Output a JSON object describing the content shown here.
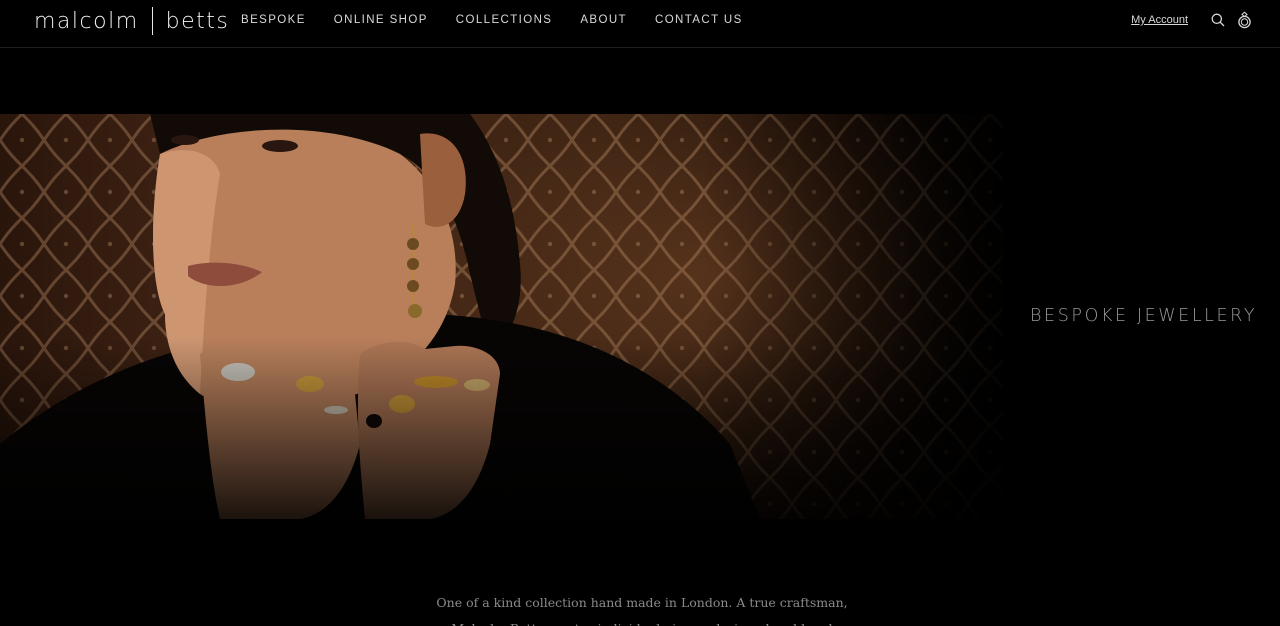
{
  "brand": {
    "left": "malcolm",
    "right": "betts"
  },
  "nav": [
    {
      "label": "BESPOKE"
    },
    {
      "label": "ONLINE SHOP"
    },
    {
      "label": "COLLECTIONS"
    },
    {
      "label": "ABOUT"
    },
    {
      "label": "CONTACT US"
    }
  ],
  "utility": {
    "account_label": "My Account",
    "search_icon": "search-icon",
    "bag_icon": "ring-bag-icon"
  },
  "hero": {
    "side_title": "BESPOKE JEWELLERY"
  },
  "intro": {
    "line1": "One of a kind collection hand made in London. A true craftsman,",
    "line2": "Malcolm Betts creates individual pieces, designed and hand"
  },
  "colors": {
    "background": "#000000",
    "accent": "#b8892f"
  }
}
